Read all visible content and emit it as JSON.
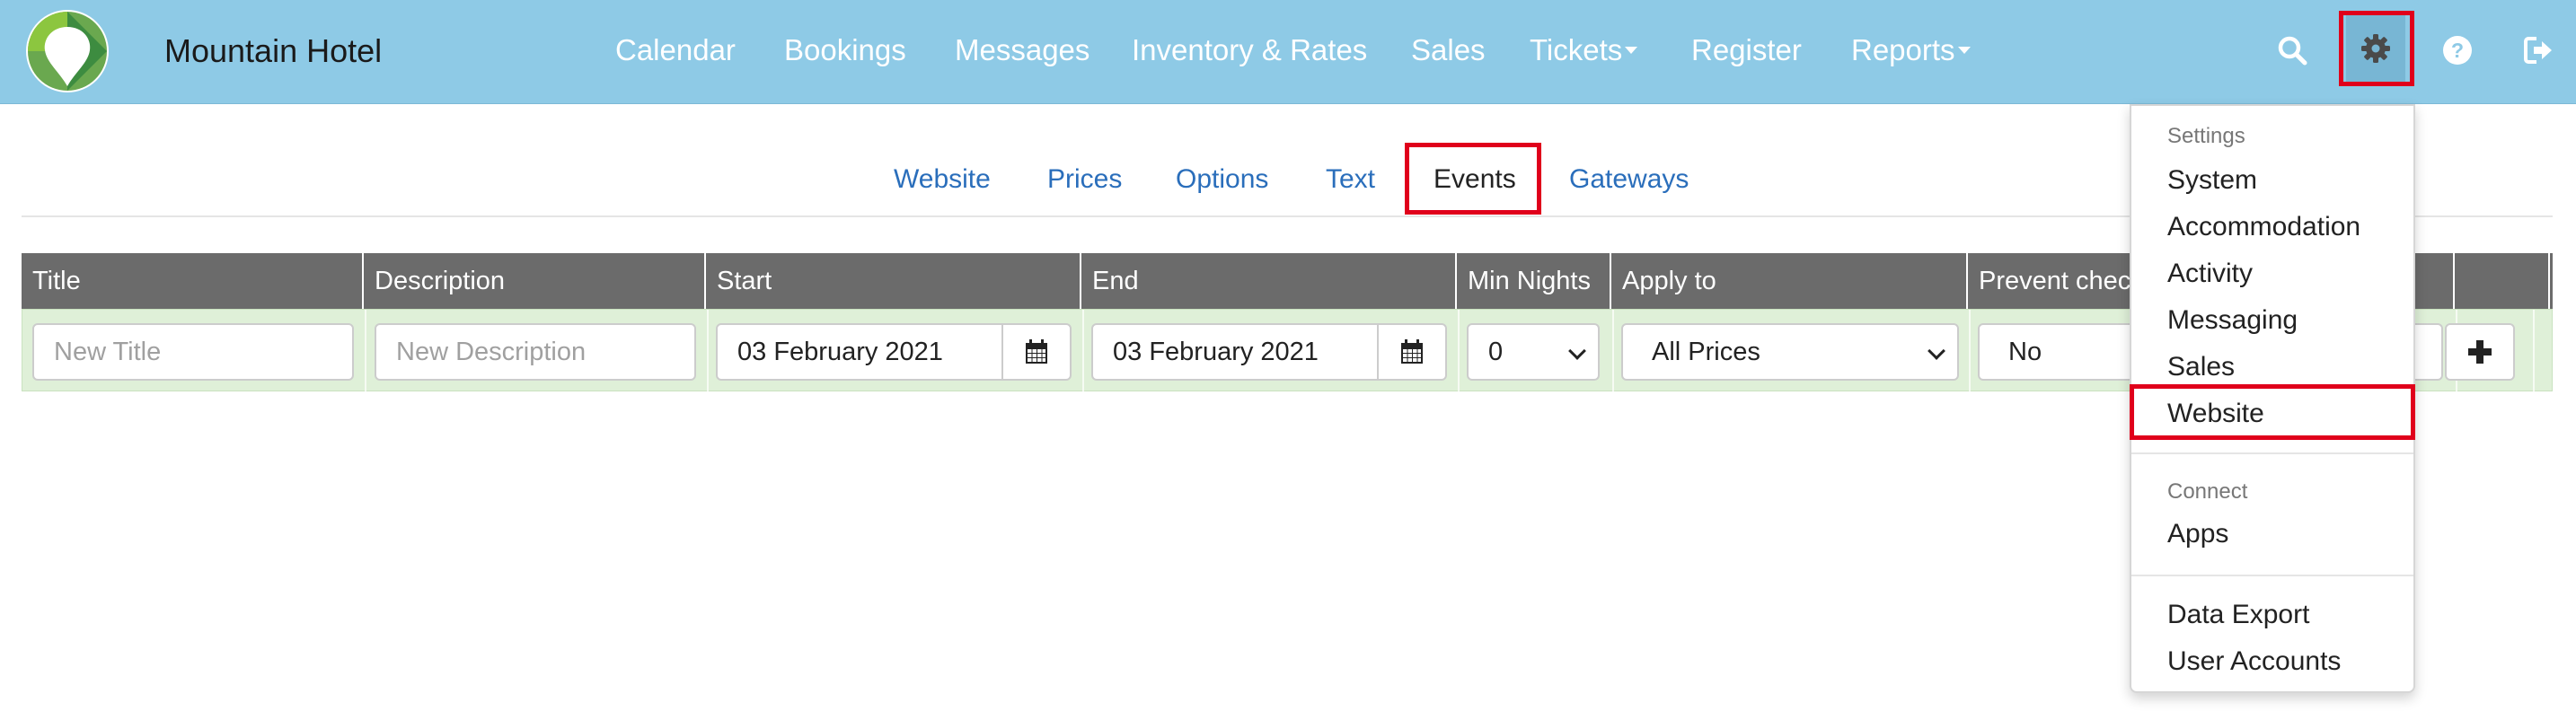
{
  "colors": {
    "navbar": "#8ecae6",
    "link": "#2a6ebb",
    "table_header": "#6b6b6b",
    "row_bg": "#dff0d8",
    "highlight": "#e0001b"
  },
  "brand": {
    "name": "Mountain Hotel",
    "logo_icon": "hotel-logo"
  },
  "nav": {
    "items": [
      {
        "label": "Calendar"
      },
      {
        "label": "Bookings"
      },
      {
        "label": "Messages"
      },
      {
        "label": "Inventory & Rates"
      },
      {
        "label": "Sales"
      },
      {
        "label": "Tickets",
        "has_caret": true
      },
      {
        "label": "Register"
      },
      {
        "label": "Reports",
        "has_caret": true
      }
    ],
    "icons": [
      "search-icon",
      "gear-icon",
      "help-icon",
      "logout-icon"
    ]
  },
  "tabs": [
    {
      "label": "Website"
    },
    {
      "label": "Prices"
    },
    {
      "label": "Options"
    },
    {
      "label": "Text"
    },
    {
      "label": "Events",
      "active": true
    },
    {
      "label": "Gateways"
    }
  ],
  "table": {
    "columns": [
      "Title",
      "Description",
      "Start",
      "End",
      "Min Nights",
      "Apply to",
      "Prevent check",
      "",
      ""
    ],
    "new_row": {
      "title_placeholder": "New Title",
      "description_placeholder": "New Description",
      "start": "03 February 2021",
      "end": "03 February 2021",
      "min_nights": "0",
      "apply_to": "All Prices",
      "prevent_checkin": "No"
    }
  },
  "settings_menu": {
    "header": "Settings",
    "items": [
      "System",
      "Accommodation",
      "Activity",
      "Messaging",
      "Sales",
      "Website"
    ],
    "connect_header": "Connect",
    "connect_items": [
      "Apps"
    ],
    "other_items": [
      "Data Export",
      "User Accounts"
    ]
  }
}
